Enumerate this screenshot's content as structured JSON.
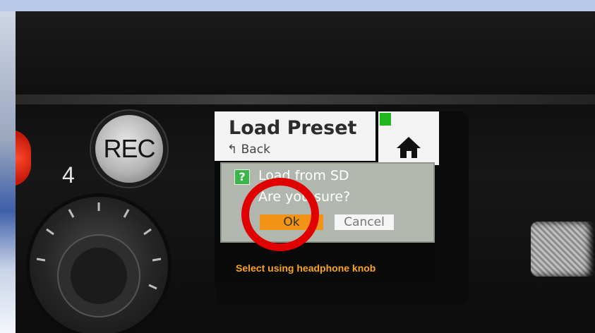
{
  "device": {
    "rec_label": "REC",
    "knob_number": "4"
  },
  "screen": {
    "title": "Load Preset",
    "back_label": "↰ Back",
    "home_icon": "home-icon",
    "dialog": {
      "icon": "?",
      "title": "Load from SD",
      "message": "Are you sure?",
      "ok_label": "Ok",
      "cancel_label": "Cancel"
    },
    "hint": "Select using headphone knob"
  },
  "colors": {
    "highlight_circle": "#e00000",
    "ok_button": "#f29216",
    "hint_text": "#f8a41e",
    "level_indicator": "#1fb81f"
  }
}
